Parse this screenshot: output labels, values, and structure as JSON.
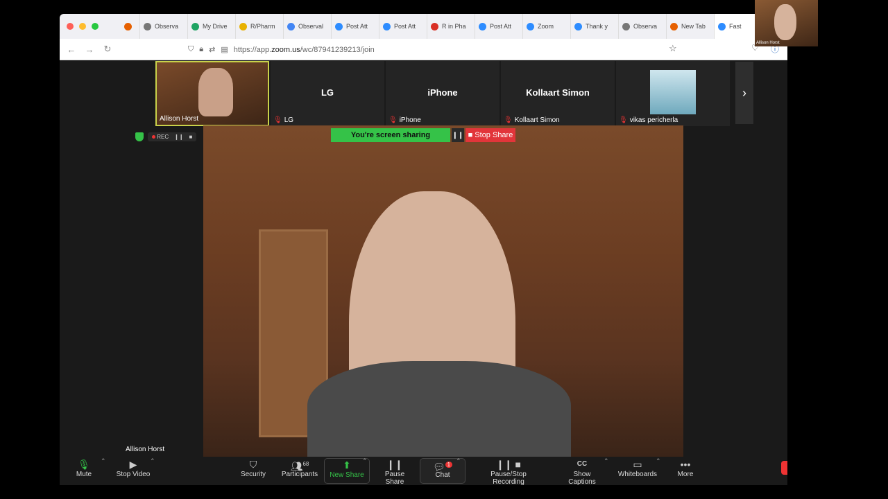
{
  "browser": {
    "tabs": [
      {
        "label": "Observa",
        "color": "#777"
      },
      {
        "label": "My Drive",
        "color": "#1fa463"
      },
      {
        "label": "R/Pharm",
        "color": "#e8b100"
      },
      {
        "label": "Observal",
        "color": "#4285f4"
      },
      {
        "label": "Post Att",
        "color": "#2d8cff"
      },
      {
        "label": "Post Att",
        "color": "#2d8cff"
      },
      {
        "label": "R in Pha",
        "color": "#d93025"
      },
      {
        "label": "Post Att",
        "color": "#2d8cff"
      },
      {
        "label": "Zoom",
        "color": "#2d8cff"
      },
      {
        "label": "Thank y",
        "color": "#2d8cff"
      },
      {
        "label": "Observa",
        "color": "#777"
      },
      {
        "label": "New Tab",
        "color": "#e66000"
      },
      {
        "label": "Fast",
        "color": "#2d8cff"
      }
    ],
    "url_prefix": "https://app.",
    "url_domain": "zoom.us",
    "url_path": "/wc/87941239213/join"
  },
  "strip": {
    "tiles": [
      {
        "name": "Allison Horst"
      },
      {
        "center": "LG",
        "name": "LG"
      },
      {
        "center": "iPhone",
        "name": "iPhone"
      },
      {
        "center": "Kollaart Simon",
        "name": "Kollaart Simon"
      },
      {
        "name": "vikas pericherla"
      }
    ]
  },
  "share": {
    "status": "You're screen sharing",
    "stop": "Stop Share"
  },
  "rec": {
    "label": "REC"
  },
  "speaker": "Allison Horst",
  "toolbar": {
    "mute": "Mute",
    "stop_video": "Stop Video",
    "security": "Security",
    "participants": "Participants",
    "participants_count": "68",
    "new_share": "New Share",
    "pause_share": "Pause Share",
    "chat": "Chat",
    "chat_badge": "1",
    "recording": "Pause/Stop Recording",
    "captions": "Show Captions",
    "captions_icon": "CC",
    "whiteboards": "Whiteboards",
    "more": "More"
  },
  "pip": {
    "name": "Allison Horst"
  }
}
